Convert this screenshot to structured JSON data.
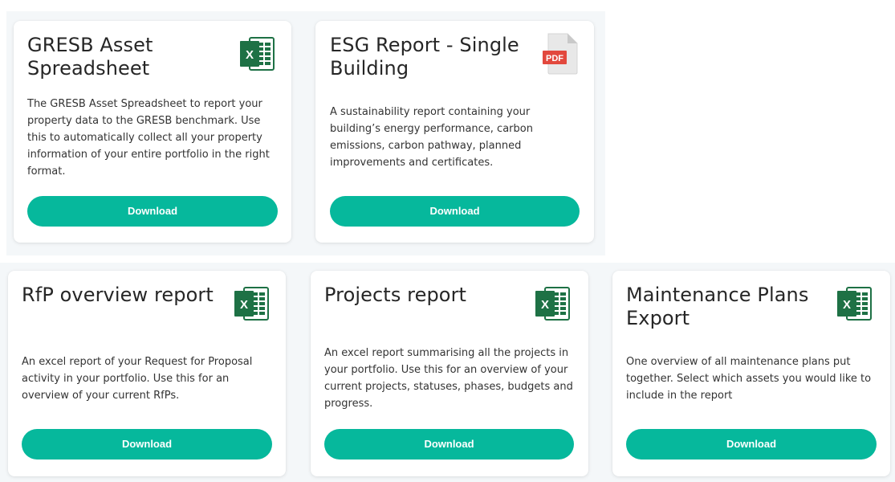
{
  "colors": {
    "accent": "#06b89c",
    "excel_green": "#1e7145",
    "pdf_red": "#e2483d",
    "background_panel": "#f4f7f9"
  },
  "cards": [
    {
      "title": "GRESB Asset Spreadsheet",
      "description": "The GRESB Asset Spreadsheet to report your property data to the GRESB benchmark. Use this to automatically collect all your property information of your entire portfolio in the right format.",
      "icon": "excel-icon",
      "icon_letter": "X",
      "button_label": "Download"
    },
    {
      "title": "ESG Report - Single Building",
      "description": "A sustainability report containing your building’s energy performance, carbon emissions, carbon pathway, planned improvements and certificates.",
      "icon": "pdf-icon",
      "icon_letter": "PDF",
      "button_label": "Download"
    },
    {
      "title": "RfP overview report",
      "description": "An excel report of your Request for Proposal activity in your portfolio. Use this for an overview of your current RfPs.",
      "icon": "excel-icon",
      "icon_letter": "X",
      "button_label": "Download"
    },
    {
      "title": "Projects report",
      "description": "An excel report summarising all the projects in your portfolio. Use this for an overview of your current projects, statuses, phases, budgets and progress.",
      "icon": "excel-icon",
      "icon_letter": "X",
      "button_label": "Download"
    },
    {
      "title": "Maintenance Plans Export",
      "description": "One overview of all maintenance plans put together. Select which assets you would like to include in the report",
      "icon": "excel-icon",
      "icon_letter": "X",
      "button_label": "Download"
    }
  ]
}
